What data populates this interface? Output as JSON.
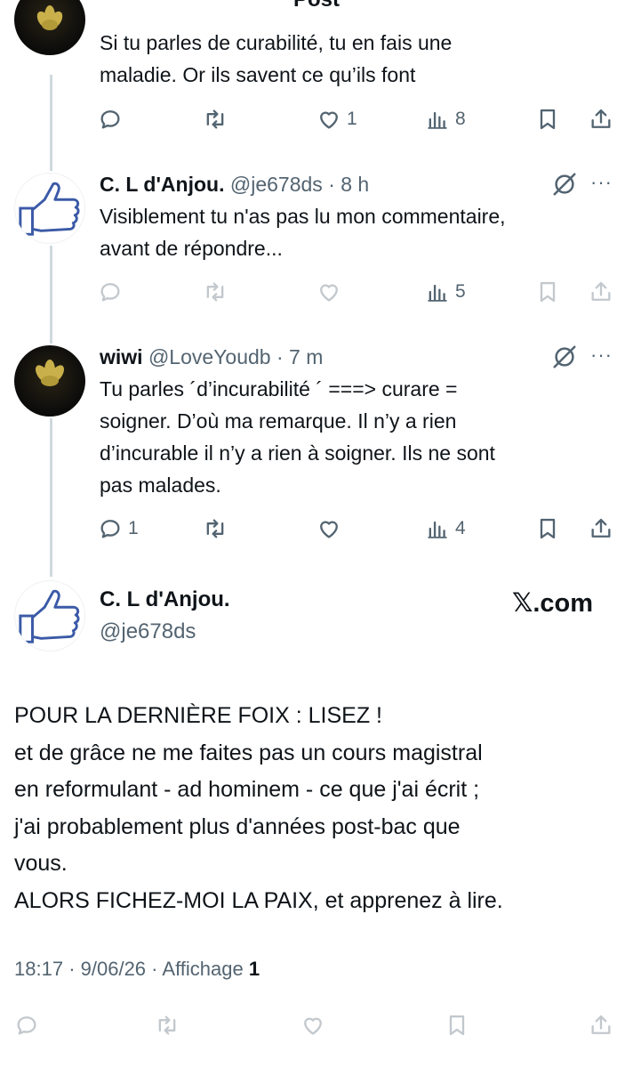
{
  "header": {
    "title": "Post",
    "back_icon": "back-arrow-icon",
    "more_icon": "more-icon"
  },
  "reply0": {
    "text_lines": [
      "Si tu parles de curabilité, tu en fais une",
      "maladie. Or ils savent ce qu’ils font"
    ],
    "likes": "1",
    "views": "8"
  },
  "reply1": {
    "name": "C. L d'Anjou.",
    "handle": "@je678ds",
    "dot": "·",
    "time": "8 h",
    "text_lines": [
      "Visiblement tu n'as pas lu mon commentaire,",
      "avant de répondre..."
    ],
    "views": "5"
  },
  "reply2": {
    "name": "wiwi",
    "handle": "@LoveYoudb",
    "dot": "·",
    "time": "7 m",
    "text_lines": [
      "Tu parles ´d’incurabilité ´ ===> curare =",
      "soigner. D’où ma remarque. Il n’y a rien",
      "d’incurable il n’y a rien à soigner. Ils ne sont",
      "pas malades."
    ],
    "replies": "1",
    "views": "4"
  },
  "main": {
    "name": "C. L d'Anjou.",
    "handle": "@je678ds",
    "source": "𝕏.com",
    "text_lines": [
      "POUR LA DERNIÈRE FOIX : LISEZ !",
      "et de grâce ne me faites pas un cours magistral",
      "en reformulant - ad hominem - ce que j'ai écrit ;",
      "j'ai probablement plus d'années post-bac que",
      "vous.",
      "ALORS FICHEZ-MOI LA PAIX, et apprenez à lire."
    ],
    "time": "18:17",
    "sep1": "·",
    "date": "9/06/26",
    "sep2": "·",
    "views_label": "Affichage",
    "views_count": "1"
  },
  "colors": {
    "text": "#0f1419",
    "muted": "#536471",
    "thread_line": "#cfd9de"
  }
}
